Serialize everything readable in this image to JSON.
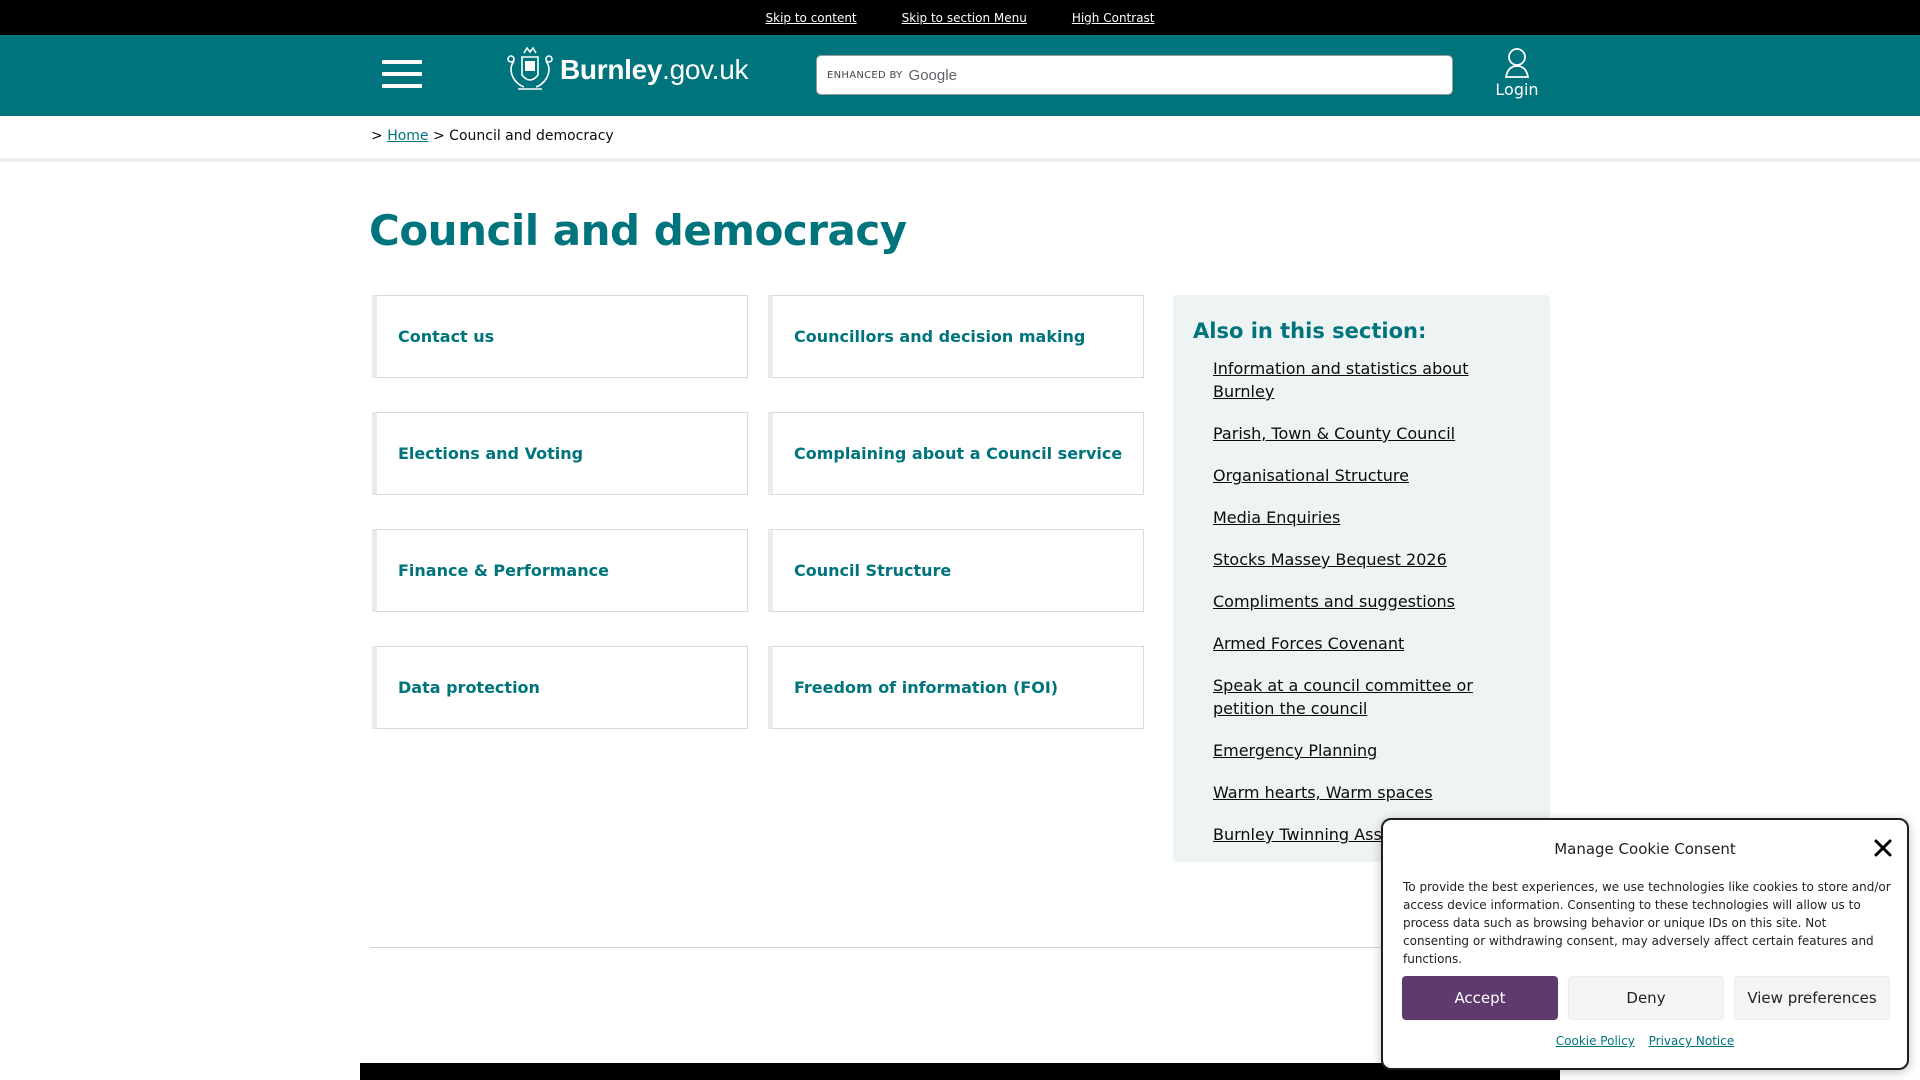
{
  "skip_links": [
    "Skip to content",
    "Skip to section Menu",
    "High Contrast"
  ],
  "header": {
    "brand_bold": "Burnley",
    "brand_light": ".gov.uk",
    "search_enhanced": "ENHANCED BY",
    "search_google": "Google",
    "login_label": "Login"
  },
  "breadcrumb": {
    "sep": ">",
    "home": "Home",
    "current": "Council and democracy"
  },
  "page_title": "Council and democracy",
  "cards": [
    "Contact us",
    "Councillors and decision making",
    "Elections and Voting",
    "Complaining about a Council service",
    "Finance & Performance",
    "Council Structure",
    "Data protection",
    "Freedom of information (FOI)"
  ],
  "sidebar": {
    "heading": "Also in this section:",
    "links": [
      "Information and statistics about Burnley",
      "Parish, Town & County Council",
      "Organisational Structure",
      "Media Enquiries",
      "Stocks Massey Bequest 2026",
      "Compliments and suggestions",
      "Armed Forces Covenant",
      "Speak at a council committee or petition the council",
      "Emergency Planning",
      "Warm hearts, Warm spaces",
      "Burnley Twinning Association"
    ]
  },
  "cookie": {
    "title": "Manage Cookie Consent",
    "body": "To provide the best experiences, we use technologies like cookies to store and/or access device information. Consenting to these technologies will allow us to process data such as browsing behavior or unique IDs on this site. Not consenting or withdrawing consent, may adversely affect certain features and functions.",
    "accept": "Accept",
    "deny": "Deny",
    "preferences": "View preferences",
    "cookie_policy": "Cookie Policy",
    "privacy_notice": "Privacy Notice"
  },
  "colors": {
    "brand_teal": "#00747c",
    "accept_purple": "#5e3a6e",
    "sidebar_bg": "#eef3f3"
  }
}
